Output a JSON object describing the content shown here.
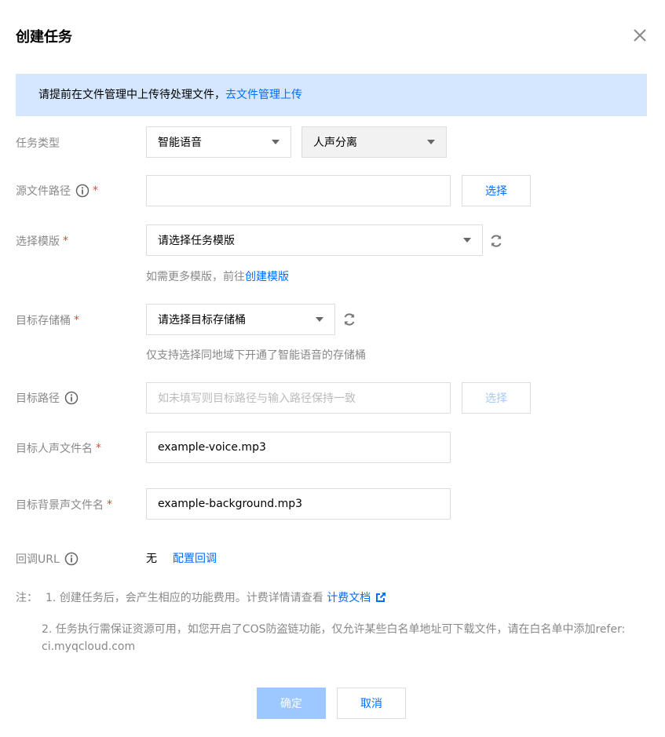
{
  "dialog": {
    "title": "创建任务"
  },
  "notice": {
    "text": "请提前在文件管理中上传待处理文件，",
    "link": "去文件管理上传"
  },
  "form": {
    "task_type": {
      "label": "任务类型",
      "value1": "智能语音",
      "value2": "人声分离"
    },
    "source_path": {
      "label": "源文件路径",
      "required": "*",
      "value": "",
      "button": "选择"
    },
    "template": {
      "label": "选择模版",
      "required": "*",
      "placeholder": "请选择任务模版",
      "hint_text": "如需更多模版，前往",
      "hint_link": "创建模版"
    },
    "target_bucket": {
      "label": "目标存储桶",
      "required": "*",
      "placeholder": "请选择目标存储桶",
      "hint": "仅支持选择同地域下开通了智能语音的存储桶"
    },
    "target_path": {
      "label": "目标路径",
      "placeholder": "如未填写则目标路径与输入路径保持一致",
      "button": "选择"
    },
    "voice_file": {
      "label": "目标人声文件名",
      "required": "*",
      "value": "example-voice.mp3"
    },
    "background_file": {
      "label": "目标背景声文件名",
      "required": "*",
      "value": "example-background.mp3"
    },
    "callback": {
      "label": "回调URL",
      "value": "无",
      "link": "配置回调"
    }
  },
  "notes": {
    "prefix": "注：",
    "item1_text": "1. 创建任务后，会产生相应的功能费用。计费详情请查看",
    "item1_link": "计费文档",
    "item2": "2. 任务执行需保证资源可用，如您开启了COS防盗链功能，仅允许某些白名单地址可下载文件，请在白名单中添加refer: ci.myqcloud.com"
  },
  "footer": {
    "confirm": "确定",
    "cancel": "取消"
  },
  "colors": {
    "accent": "#006eff",
    "notice_bg": "#d5e7ff",
    "required": "#e54545",
    "primary_disabled": "#9dc7ff"
  },
  "icons": [
    "close-icon",
    "info-icon",
    "chevron-down-icon",
    "refresh-icon",
    "external-link-icon"
  ]
}
